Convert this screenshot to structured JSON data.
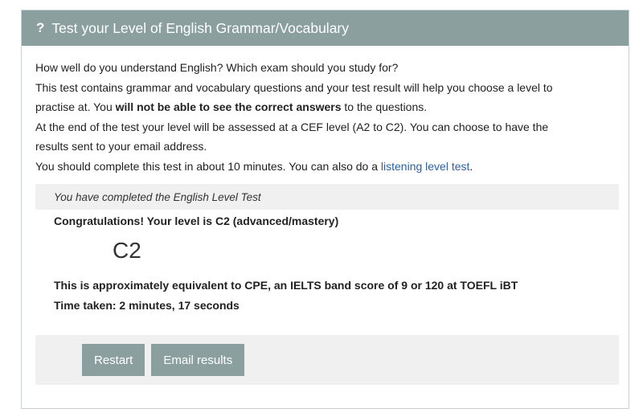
{
  "header": {
    "icon": "question-mark-icon",
    "icon_glyph": "?",
    "title": "Test your Level of English Grammar/Vocabulary"
  },
  "intro": {
    "line1": "How well do you understand English? Which exam should you study for?",
    "line2": "This test contains grammar and vocabulary questions and your test result will help you choose a level to",
    "line3_pre": "practise at. You ",
    "line3_bold": "will not be able to see the correct answers",
    "line3_post": " to the questions.",
    "line4": "At the end of the test your level will be assessed at a CEF level (A2 to C2). You can choose to have the",
    "line5": "results sent to your email address.",
    "line6_pre": "You should complete this test in about 10 minutes. You can also do a ",
    "line6_link": "listening level test",
    "line6_post": "."
  },
  "result": {
    "completed_text": "You have completed the English Level Test",
    "congrats_text": "Congratulations! Your level is C2 (advanced/mastery)",
    "level": "C2",
    "equivalence_text": "This is approximately equivalent to CPE, an IELTS band score of 9 or 120 at TOEFL iBT",
    "time_taken": "Time taken: 2 minutes, 17 seconds"
  },
  "actions": {
    "restart_label": "Restart",
    "email_label": "Email results"
  },
  "colors": {
    "header_bg": "#8b9f9f",
    "button_bg": "#8b9f9f",
    "link": "#2a5fa0",
    "result_bg": "#f0f0f0"
  }
}
